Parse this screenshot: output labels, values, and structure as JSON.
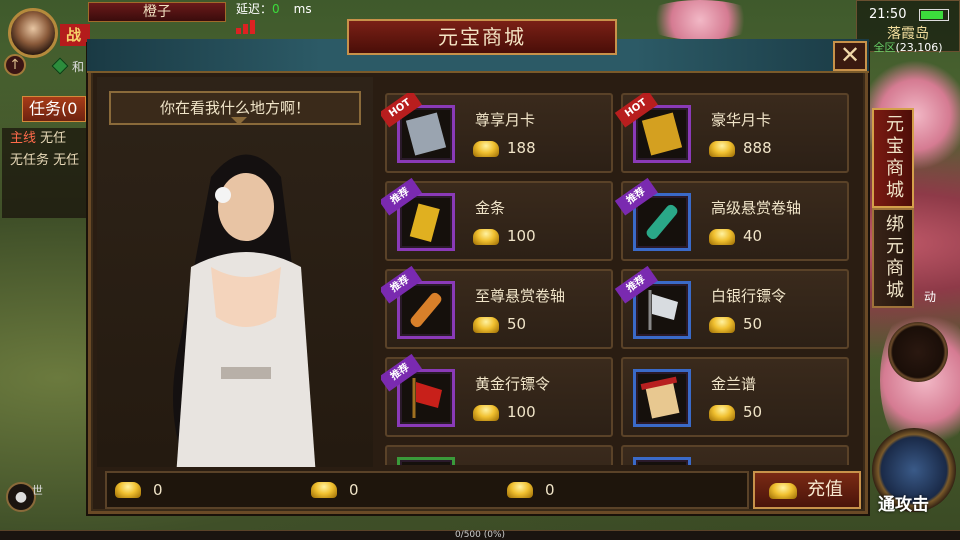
{
  "hud": {
    "player_name": "橙子",
    "hp_label": "战",
    "map_label": "和",
    "latency_label": "延迟：",
    "latency_value": "0",
    "latency_unit": "ms",
    "quest_tab": "任务(0",
    "quests": [
      {
        "tag": "主线",
        "text": "无任"
      },
      {
        "tag": "",
        "text": "无任务  无任"
      }
    ],
    "clock": "21:50",
    "battery_level": 0.85,
    "location_name": "落霞岛",
    "location_area": "全区",
    "location_coords": "(23,106)",
    "voice_channel": "世",
    "exp_text": "0/500 (0%)",
    "attack_label": "通攻击",
    "side_hint": "动"
  },
  "shop": {
    "title": "元宝商城",
    "close_label": "✕",
    "npc_speech": "你在看我什么地方啊！",
    "tabs": [
      {
        "label": "元宝商城",
        "active": true
      },
      {
        "label": "绑元商城",
        "active": false
      }
    ],
    "items": [
      {
        "name": "尊享月卡",
        "price": "188",
        "badge": "HOT",
        "badge_type": "hot",
        "frame": "purple",
        "icon": "silver-card-icon"
      },
      {
        "name": "豪华月卡",
        "price": "888",
        "badge": "HOT",
        "badge_type": "hot",
        "frame": "purple",
        "icon": "gold-card-icon"
      },
      {
        "name": "金条",
        "price": "100",
        "badge": "推荐",
        "badge_type": "rec",
        "frame": "purple",
        "icon": "gold-bar-icon"
      },
      {
        "name": "高级悬赏卷轴",
        "price": "40",
        "badge": "推荐",
        "badge_type": "rec",
        "frame": "blue",
        "icon": "green-scroll-icon"
      },
      {
        "name": "至尊悬赏卷轴",
        "price": "50",
        "badge": "推荐",
        "badge_type": "rec",
        "frame": "purple",
        "icon": "orange-scroll-icon"
      },
      {
        "name": "白银行镖令",
        "price": "50",
        "badge": "推荐",
        "badge_type": "rec",
        "frame": "blue",
        "icon": "silver-flag-icon"
      },
      {
        "name": "黄金行镖令",
        "price": "100",
        "badge": "推荐",
        "badge_type": "rec",
        "frame": "purple",
        "icon": "gold-flag-icon"
      },
      {
        "name": "金兰谱",
        "price": "50",
        "badge": "",
        "badge_type": "",
        "frame": "blue",
        "icon": "red-scroll-icon"
      }
    ],
    "currencies": [
      {
        "name": "yuanbao",
        "value": "0"
      },
      {
        "name": "bound-yuanbao",
        "value": "0"
      },
      {
        "name": "gold-coins",
        "value": "0"
      }
    ],
    "recharge_label": "充值"
  }
}
